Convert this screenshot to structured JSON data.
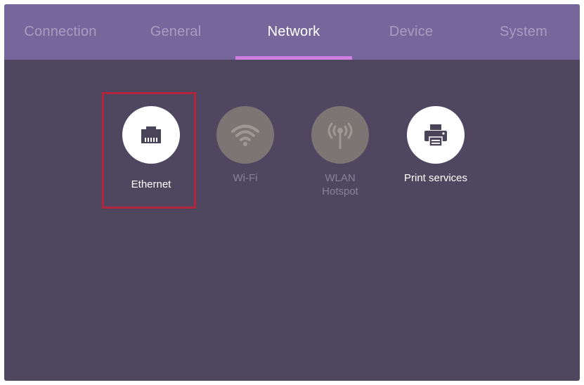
{
  "tabs": [
    {
      "label": "Connection",
      "active": false
    },
    {
      "label": "General",
      "active": false
    },
    {
      "label": "Network",
      "active": true
    },
    {
      "label": "Device",
      "active": false
    },
    {
      "label": "System",
      "active": false
    }
  ],
  "items": [
    {
      "label": "Ethernet",
      "icon": "ethernet-port-icon",
      "enabled": true,
      "focused": true
    },
    {
      "label": "Wi-Fi",
      "icon": "wifi-icon",
      "enabled": false
    },
    {
      "label_line1": "WLAN",
      "label_line2": "Hotspot",
      "icon": "hotspot-icon",
      "enabled": false
    },
    {
      "label": "Print services",
      "icon": "printer-icon",
      "enabled": true
    }
  ],
  "colors": {
    "background": "#4f4760",
    "tab_bar": "#75679b",
    "tab_indicator": "#d07ee3",
    "focus_outline": "#b3253d",
    "icon_dark": "#4a4458",
    "disabled_circle": "#7b7573"
  }
}
